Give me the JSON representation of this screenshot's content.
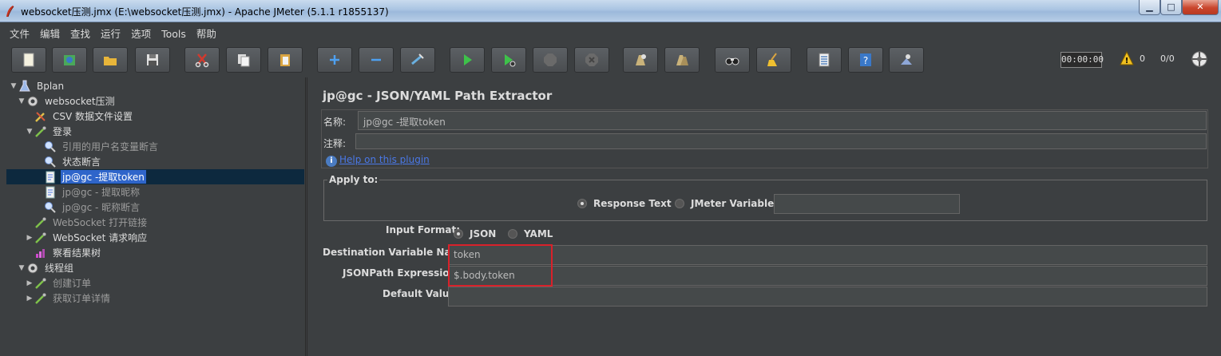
{
  "window": {
    "title": "websocket压测.jmx (E:\\websocket压测.jmx) - Apache JMeter (5.1.1 r1855137)",
    "min_label": "▁",
    "max_label": "□",
    "close_label": "✕"
  },
  "menu": [
    "文件",
    "编辑",
    "查找",
    "运行",
    "选项",
    "Tools",
    "帮助"
  ],
  "toolbar": {
    "buttons": [
      "new-icon",
      "templates-icon",
      "open-icon",
      "save-icon",
      "cut-icon",
      "copy-icon",
      "paste-icon",
      "expand-icon",
      "collapse-icon",
      "toggle-icon",
      "start-icon",
      "start-no-pause-icon",
      "stop-icon",
      "shutdown-icon",
      "clear-icon",
      "clear-all-icon",
      "search-icon",
      "reset-search-icon",
      "function-helper-icon",
      "help-icon",
      "remote-icon"
    ],
    "timer": "00:00:00",
    "warning_count": "0",
    "threads": "0/0"
  },
  "tree": [
    {
      "label": "Bplan",
      "arrow": "▼",
      "icon": "testplan-icon",
      "level": 0
    },
    {
      "label": "websocket压测",
      "arrow": "▼",
      "icon": "gear-icon",
      "level": 1
    },
    {
      "label": "CSV 数据文件设置",
      "arrow": "",
      "icon": "wrench-icon",
      "level": 2
    },
    {
      "label": "登录",
      "arrow": "▼",
      "icon": "pipette-icon",
      "level": 2
    },
    {
      "label": "引用的用户名变量断言",
      "arrow": "",
      "icon": "assertion-icon",
      "level": 3,
      "dim": true
    },
    {
      "label": "状态断言",
      "arrow": "",
      "icon": "assertion-icon",
      "level": 3
    },
    {
      "label": "jp@gc -提取token",
      "arrow": "",
      "icon": "extractor-icon",
      "level": 3,
      "selected": true
    },
    {
      "label": "jp@gc - 提取昵称",
      "arrow": "",
      "icon": "extractor-icon",
      "level": 3,
      "dim": true
    },
    {
      "label": "jp@gc - 昵称断言",
      "arrow": "",
      "icon": "assertion-icon",
      "level": 3,
      "dim": true
    },
    {
      "label": "WebSocket 打开链接",
      "arrow": "",
      "icon": "pipette-icon",
      "level": 2,
      "dim": true
    },
    {
      "label": "WebSocket 请求响应",
      "arrow": "▶",
      "icon": "pipette-icon",
      "level": 2
    },
    {
      "label": "察看结果树",
      "arrow": "",
      "icon": "listener-icon",
      "level": 2
    },
    {
      "label": "线程组",
      "arrow": "▼",
      "icon": "gear-icon",
      "level": 1
    },
    {
      "label": "创建订单",
      "arrow": "▶",
      "icon": "pipette-icon",
      "level": 2,
      "dim": true
    },
    {
      "label": "获取订单详情",
      "arrow": "▶",
      "icon": "pipette-icon",
      "level": 2,
      "dim": true
    }
  ],
  "panel": {
    "title": "jp@gc - JSON/YAML Path Extractor",
    "name_label": "名称:",
    "name_value": "jp@gc -提取token",
    "comment_label": "注释:",
    "comment_value": "",
    "help_link": "Help on this plugin",
    "apply_to": {
      "legend": "Apply to:",
      "response_text": "Response Text",
      "jmeter_variable": "JMeter Variable:",
      "variable_value": ""
    },
    "input_format": {
      "label": "Input Format:",
      "json": "JSON",
      "yaml": "YAML",
      "selected": "JSON"
    },
    "dest_var": {
      "label": "Destination Variable Name:",
      "value": "token"
    },
    "jsonpath": {
      "label": "JSONPath Expression:",
      "value": "$.body.token"
    },
    "default_value": {
      "label": "Default Value:",
      "value": ""
    }
  }
}
